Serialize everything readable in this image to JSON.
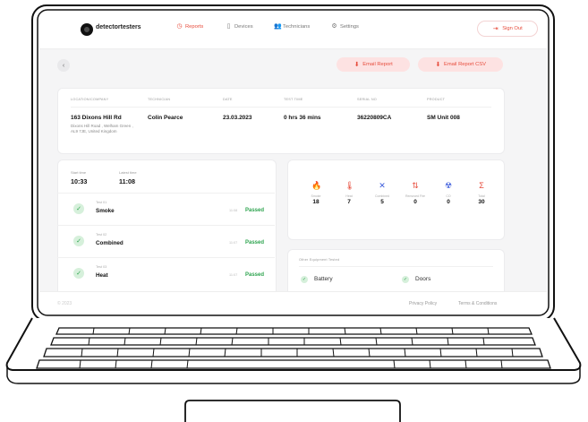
{
  "brand": "detectortesters",
  "nav": {
    "reports": "Reports",
    "devices": "Devices",
    "technicians": "Technicians",
    "settings": "Settings",
    "sign_out": "Sign Out"
  },
  "actions": {
    "email_report": "Email Report",
    "email_report_csv": "Email Report CSV"
  },
  "report_info": {
    "headers": [
      "LOCATION/COMPANY",
      "TECHNICIAN",
      "DATE",
      "TEST TIME",
      "SERIAL NO",
      "PRODUCT"
    ],
    "location_name": "163 Dixons Hill Rd",
    "location_address": "Dixons Hill Road , Welham Green , AL9 7JE, United Kingdom",
    "technician": "Colin Pearce",
    "date": "23.03.2023",
    "test_time": "0 hrs 36 mins",
    "serial_no": "36220809CA",
    "product": "SM Unit 008"
  },
  "times": {
    "start_label": "Start time",
    "start_value": "10:33",
    "end_label": "Latest time",
    "end_value": "11:08"
  },
  "tests": [
    {
      "label": "Test 01",
      "name": "Smoke",
      "time": "11:08",
      "status": "Passed"
    },
    {
      "label": "Test 02",
      "name": "Combined",
      "time": "11:07",
      "status": "Passed"
    },
    {
      "label": "Test 03",
      "name": "Heat",
      "time": "11:07",
      "status": "Passed"
    }
  ],
  "stats": [
    {
      "icon": "smoke-icon",
      "label": "Smoke",
      "value": "18",
      "color": "#3b5bdb"
    },
    {
      "icon": "heat-icon",
      "label": "Heat",
      "value": "7",
      "color": "#e74c3c"
    },
    {
      "icon": "combined-icon",
      "label": "Combined",
      "value": "5",
      "color": "#3b5bdb"
    },
    {
      "icon": "removed-icon",
      "label": "Removed Fire",
      "value": "0",
      "color": "#e74c3c"
    },
    {
      "icon": "co-icon",
      "label": "CO",
      "value": "0",
      "color": "#3b5bdb"
    },
    {
      "icon": "total-icon",
      "label": "Total",
      "value": "30",
      "color": "#e74c3c"
    }
  ],
  "equipment": {
    "title": "Other Equipment Tested",
    "items": [
      "Battery",
      "Doors"
    ]
  },
  "footer": {
    "copyright": "© 2023",
    "privacy": "Privacy Policy",
    "terms": "Terms & Conditions"
  }
}
